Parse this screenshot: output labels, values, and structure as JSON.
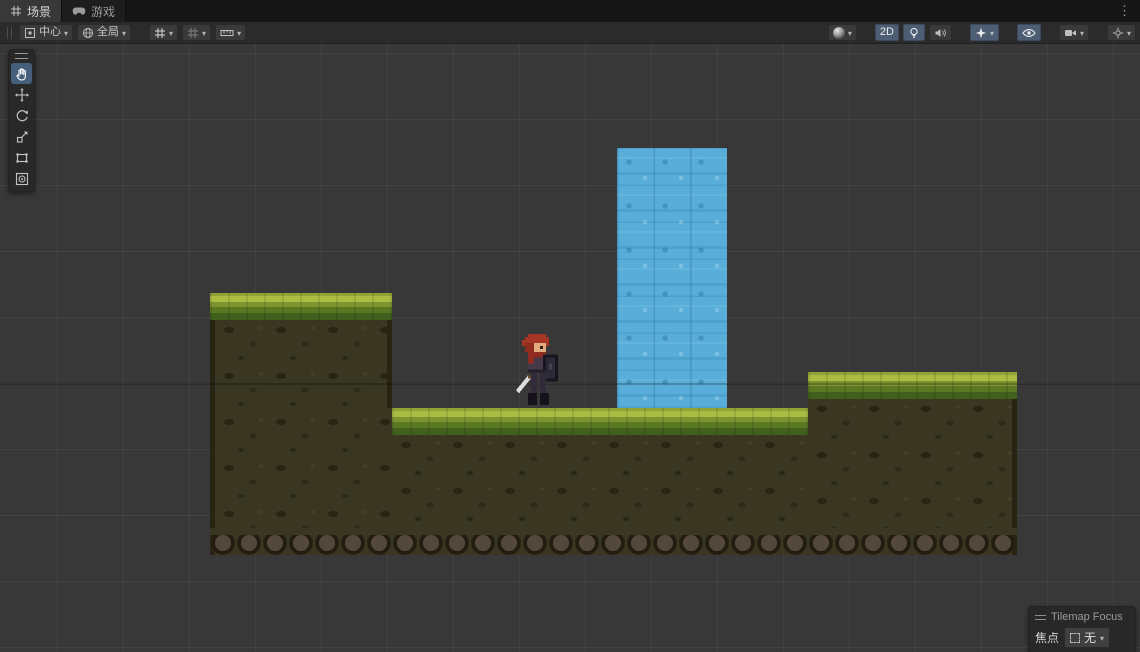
{
  "tabs": [
    {
      "label": "场景",
      "active": true
    },
    {
      "label": "游戏",
      "active": false
    }
  ],
  "tabbar": {
    "more_icon": "⋮"
  },
  "toolbar": {
    "pivot_label": "中心",
    "orientation_label": "全局",
    "mode_2d_label": "2D",
    "dropdown_icon": "▾"
  },
  "tool_palette": {
    "selected_tool": "view-hand",
    "tools": [
      "view-hand",
      "move",
      "rotate",
      "scale",
      "rect",
      "transform"
    ]
  },
  "tilemap_overlay": {
    "title": "Tilemap Focus",
    "focus_label": "焦点",
    "focus_value": "无"
  },
  "colors": {
    "accent_selected": "#46607c",
    "viewport_bg": "#383838",
    "water": "#58aed8",
    "grass": "#aabd42",
    "dirt": "#393621"
  }
}
